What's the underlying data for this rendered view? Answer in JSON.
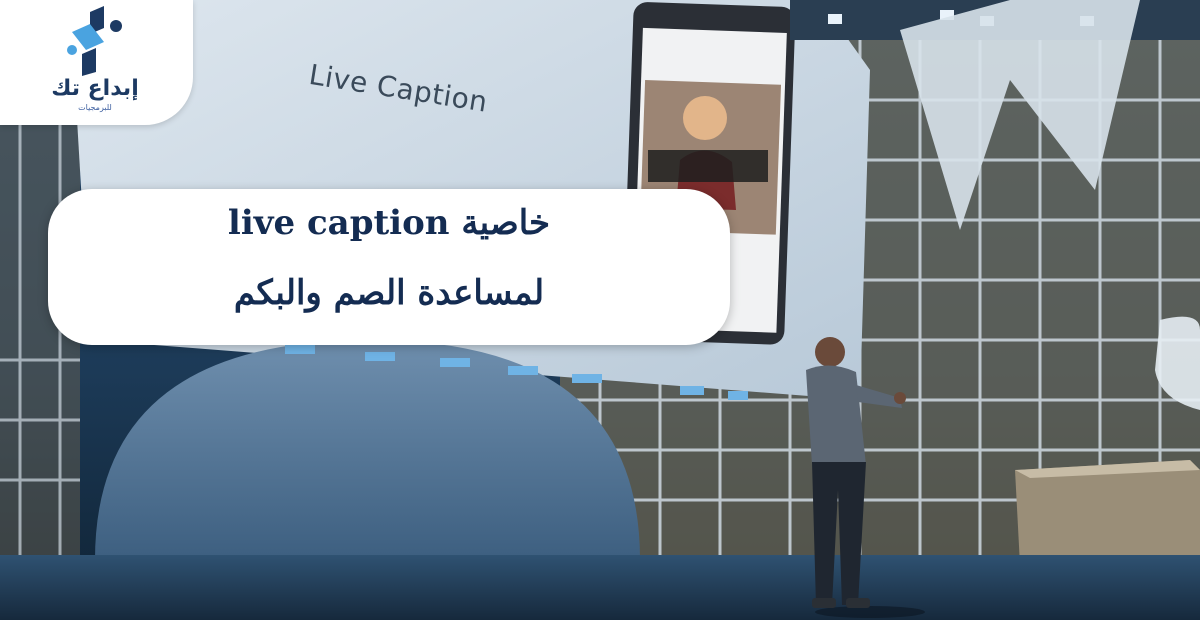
{
  "logo": {
    "name": "إبداع تك",
    "tagline": "للبرمجيات"
  },
  "screen": {
    "title": "Live Caption"
  },
  "caption": {
    "line1": "خاصية live caption",
    "line2": "لمساعدة الصم والبكم"
  },
  "colors": {
    "caption_text": "#142c52",
    "logo_dark": "#1d3a63",
    "logo_light": "#4aa3e0",
    "stage_blue": "#1b3a55"
  }
}
